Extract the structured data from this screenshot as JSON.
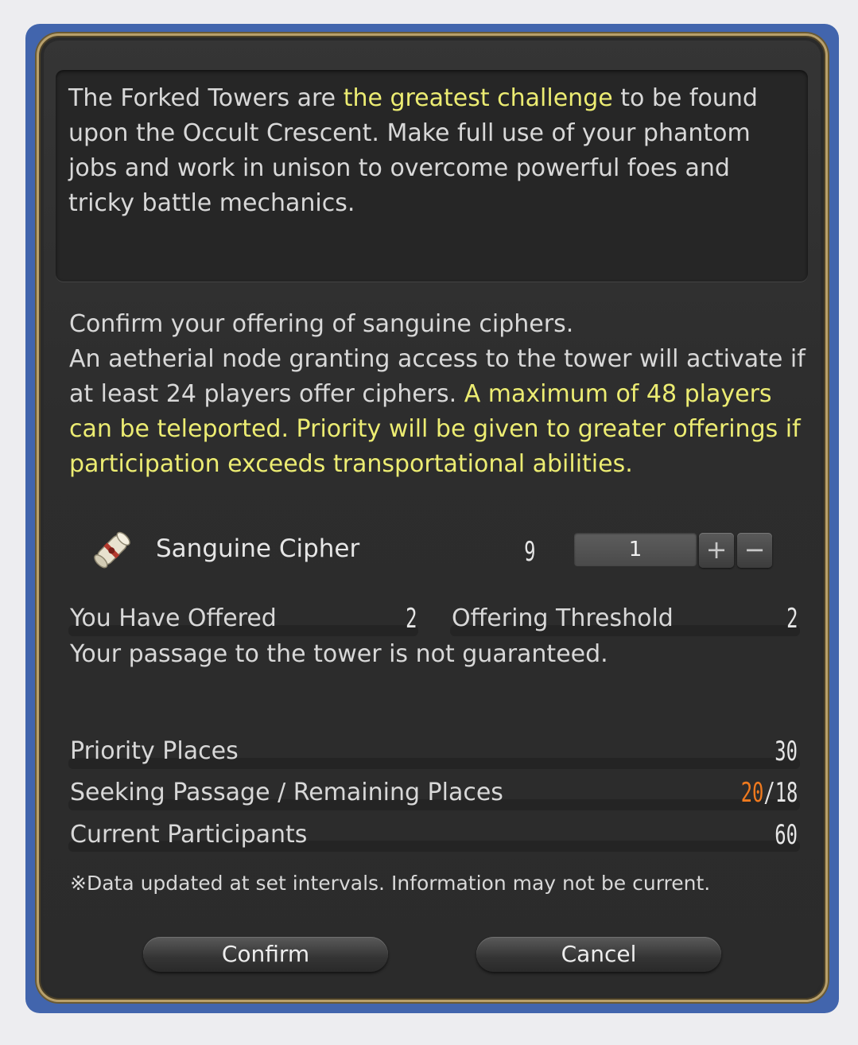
{
  "description": {
    "part1": "The Forked Towers are ",
    "highlight": "the greatest challenge",
    "part2": " to be found upon the Occult Crescent. Make full use of your phantom jobs and work in unison to overcome powerful foes and tricky battle mechanics."
  },
  "instructions": {
    "line1": "Confirm your offering of sanguine ciphers.",
    "line2": "An aetherial node granting access to the tower will activate if at least 24 players offer ciphers. ",
    "highlight": "A maximum of 48 players can be teleported. Priority will be given to greater offerings if participation exceeds transportational abilities."
  },
  "item": {
    "icon": "scroll-icon",
    "name": "Sanguine Cipher",
    "owned": "9",
    "quantity": "1",
    "plus_label": "+",
    "minus_label": "−"
  },
  "offer": {
    "offered_label": "You Have Offered",
    "offered_value": "2",
    "threshold_label": "Offering Threshold",
    "threshold_value": "2",
    "status": "Your passage to the tower is not guaranteed."
  },
  "places": {
    "priority_label": "Priority Places",
    "priority_value": "30",
    "seeking_label": "Seeking Passage / Remaining Places",
    "seeking_value": "20",
    "remaining_value": "/18",
    "participants_label": "Current Participants",
    "participants_value": "60"
  },
  "notice": "※Data updated at set intervals. Information may not be current.",
  "buttons": {
    "confirm": "Confirm",
    "cancel": "Cancel"
  },
  "colors": {
    "frame": "#4265ad",
    "highlight_yellow": "#ecec72",
    "warning_orange": "#e5a93b",
    "over_value_orange": "#f07a1e"
  }
}
